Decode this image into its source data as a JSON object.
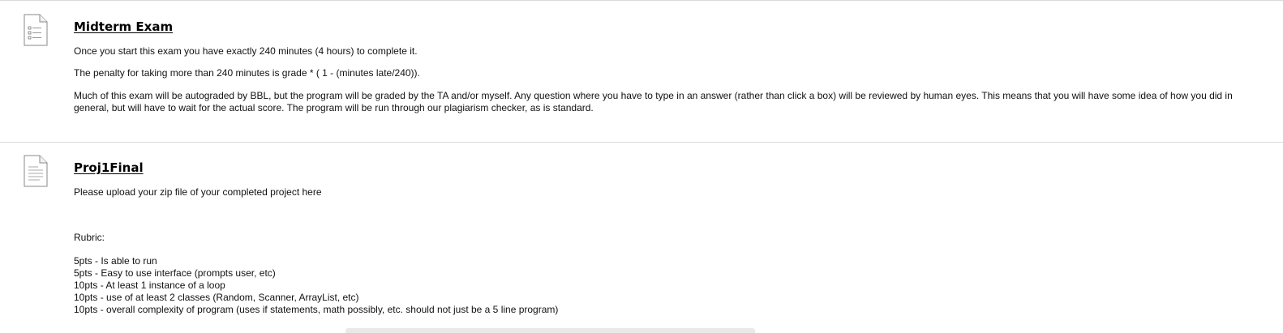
{
  "items": [
    {
      "title": "Midterm Exam",
      "icon": "test-icon",
      "paragraphs": [
        "Once you start this exam you have exactly 240 minutes (4 hours) to complete it.",
        "The penalty for taking more than 240 minutes is grade * ( 1 - (minutes late/240)).",
        "Much of this exam will be autograded by BBL, but the program will be graded by the TA and/or myself. Any question where you have to type in an answer (rather than click a box) will be reviewed by human eyes. This means that you will have some idea of how you did in general, but will have to wait for the actual score. The program will be run through our plagiarism checker, as is standard."
      ]
    },
    {
      "title": "Proj1Final",
      "icon": "document-icon",
      "intro": "Please upload your zip file of your completed project here",
      "rubric_heading": "Rubric:",
      "rubric": [
        "5pts - Is able to run",
        "5pts - Easy to use interface (prompts user, etc)",
        "10pts - At least 1 instance of a loop",
        "10pts - use of at least 2 classes (Random, Scanner, ArrayList, etc)",
        "10pts - overall complexity of program (uses if statements, math possibly, etc. should not just be a 5 line program)"
      ]
    }
  ]
}
